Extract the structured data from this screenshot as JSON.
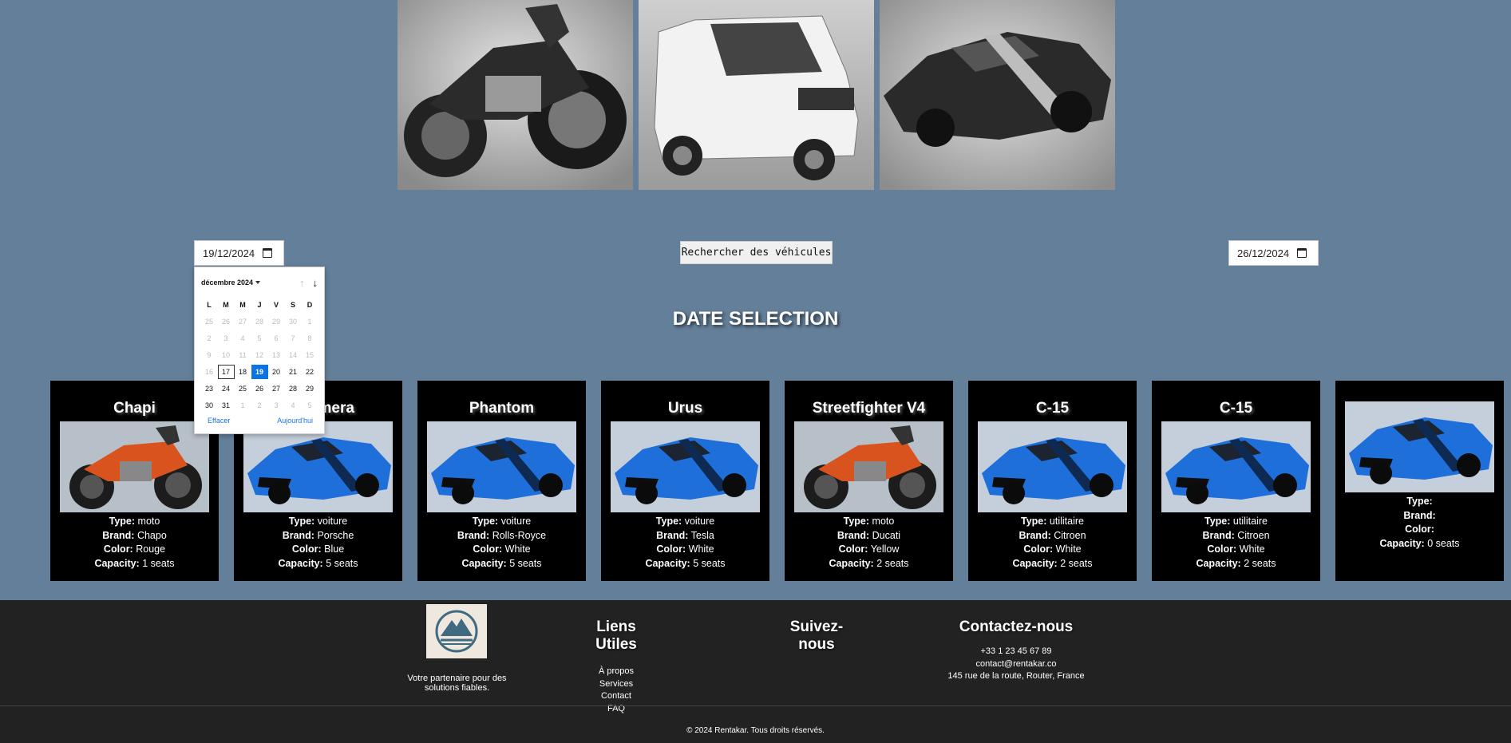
{
  "search": {
    "start_date": "19/12/2024",
    "end_date": "26/12/2024",
    "button_label": "Rechercher des véhicules"
  },
  "section_title": "DATE SELECTION",
  "labels": {
    "type": "Type:",
    "brand": "Brand:",
    "color": "Color:",
    "capacity": "Capacity:"
  },
  "cards": [
    {
      "name": "Chapi",
      "type": "moto",
      "brand": "Chapo",
      "color": "Rouge",
      "capacity": "1 seats",
      "image": "motorcycle-orange"
    },
    {
      "name": "Panamera",
      "type": "voiture",
      "brand": "Porsche",
      "color": "Blue",
      "capacity": "5 seats",
      "image": "car-blue"
    },
    {
      "name": "Phantom",
      "type": "voiture",
      "brand": "Rolls-Royce",
      "color": "White",
      "capacity": "5 seats",
      "image": "car-blue"
    },
    {
      "name": "Urus",
      "type": "voiture",
      "brand": "Tesla",
      "color": "White",
      "capacity": "5 seats",
      "image": "car-blue"
    },
    {
      "name": "Streetfighter V4",
      "type": "moto",
      "brand": "Ducati",
      "color": "Yellow",
      "capacity": "2 seats",
      "image": "motorcycle-orange"
    },
    {
      "name": "C-15",
      "type": "utilitaire",
      "brand": "Citroen",
      "color": "White",
      "capacity": "2 seats",
      "image": "car-blue"
    },
    {
      "name": "C-15",
      "type": "utilitaire",
      "brand": "Citroen",
      "color": "White",
      "capacity": "2 seats",
      "image": "car-blue"
    },
    {
      "name": "",
      "type": "",
      "brand": "",
      "color": "",
      "capacity": "0 seats",
      "image": "car-blue"
    }
  ],
  "calendar": {
    "month_label": "décembre 2024",
    "weekdays": [
      "L",
      "M",
      "M",
      "J",
      "V",
      "S",
      "D"
    ],
    "weeks": [
      [
        "25",
        "26",
        "27",
        "28",
        "29",
        "30",
        "1"
      ],
      [
        "2",
        "3",
        "4",
        "5",
        "6",
        "7",
        "8"
      ],
      [
        "9",
        "10",
        "11",
        "12",
        "13",
        "14",
        "15"
      ],
      [
        "16",
        "17",
        "18",
        "19",
        "20",
        "21",
        "22"
      ],
      [
        "23",
        "24",
        "25",
        "26",
        "27",
        "28",
        "29"
      ],
      [
        "30",
        "31",
        "1",
        "2",
        "3",
        "4",
        "5"
      ]
    ],
    "selected_day": "19",
    "today_day": "17",
    "clear_label": "Effacer",
    "today_label": "Aujourd'hui",
    "selected_color": "#0b73e5"
  },
  "footer": {
    "tagline": "Votre partenaire pour des solutions fiables.",
    "links_title": "Liens Utiles",
    "links": [
      "À propos",
      "Services",
      "Contact",
      "FAQ"
    ],
    "follow_title": "Suivez-nous",
    "contact_title": "Contactez-nous",
    "phone": "+33 1 23 45 67 89",
    "email": "contact@rentakar.co",
    "address": "145 rue de la route, Router, France",
    "copyright": "© 2024 Rentakar. Tous droits réservés."
  },
  "colors": {
    "page_bg": "#647f99",
    "card_bg": "#000000",
    "footer_bg": "#222222",
    "link_blue": "#1a73e8"
  }
}
